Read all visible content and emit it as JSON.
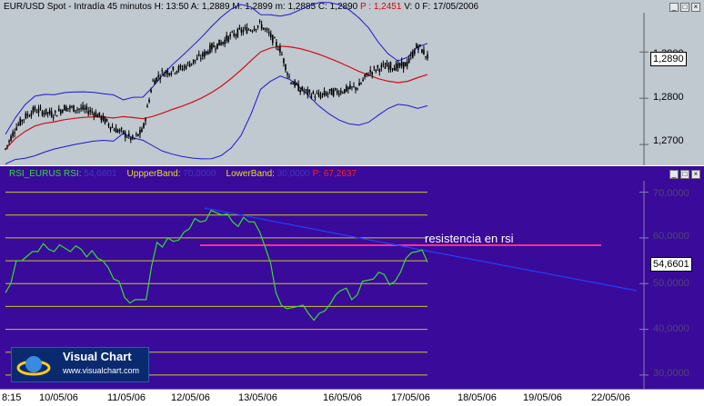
{
  "price_panel": {
    "symbol": "EUR/USD Spot",
    "period": "Intradía 45 minutos",
    "h_label": "H:",
    "h_value": "13:50",
    "a_label": "A:",
    "a_value": "1,2889",
    "m_label": "M:",
    "m_value": "1,2899",
    "mn_label": "m:",
    "mn_value": "1,2885",
    "c_label": "C:",
    "c_value": "1,2890",
    "p_label": "P :",
    "p_value": "1,2451",
    "v_label": "V:",
    "v_value": "0",
    "f_label": "F:",
    "f_value": "17/05/2006",
    "axis_ticks": [
      "1,2900",
      "1,2800",
      "1,2700"
    ],
    "last_value": "1,2890"
  },
  "rsi_panel": {
    "name": "RSI_EURUS",
    "rsi_label": "RSI:",
    "rsi_value": "54,6601",
    "upper_label": "UppperBand:",
    "upper_value": "70,0000",
    "lower_label": "LowerBand:",
    "lower_value": "30,0000",
    "p_label": "P:",
    "p_value": "67,2637",
    "annotation": "resistencia en rsi",
    "axis_ticks": [
      "70,0000",
      "60,0000",
      "50,0000",
      "40,0000",
      "30,0000"
    ],
    "last_value": "54,6601"
  },
  "x_axis": [
    "8:15",
    "10/05/06",
    "11/05/06",
    "12/05/06",
    "13/05/06",
    "16/05/06",
    "17/05/06",
    "18/05/06",
    "19/05/06",
    "22/05/06"
  ],
  "logo": {
    "title": "Visual Chart",
    "url": "www.visualchart.com"
  },
  "colors": {
    "price_bg": "#c0c8d0",
    "rsi_bg": "#3a0a9a",
    "candles": "#000000",
    "bollinger": "#1a1acc",
    "sma": "#d01010",
    "rsi_line": "#30e030",
    "band": "#c8c820",
    "resistance": "#ff3090",
    "trend": "#2040ff"
  },
  "chart_data": [
    {
      "type": "line",
      "title": "",
      "series": [
        {
          "name": "",
          "values": [
            1.269,
            1.2735,
            1.276,
            1.2775,
            1.277,
            1.2765,
            1.278,
            1.2778,
            1.2776,
            1.277,
            1.2755,
            1.2735,
            1.2725,
            1.271,
            1.273,
            1.2835,
            1.2855,
            1.286,
            1.2865,
            1.2878,
            1.289,
            1.291,
            1.292,
            1.2935,
            1.2945,
            1.295,
            1.296,
            1.2935,
            1.2905,
            1.284,
            1.282,
            1.281,
            1.2805,
            1.2812,
            1.2815,
            1.282,
            1.2825,
            1.2855,
            1.2865,
            1.287,
            1.2868,
            1.2875,
            1.2915,
            1.289
          ]
        }
      ],
      "ylim": [
        1.2655,
        1.2985
      ],
      "x_categories": [
        "8:15",
        "10/05/06",
        "11/05/06",
        "12/05/06",
        "13/05/06",
        "16/05/06",
        "17/05/06",
        "18/05/06",
        "19/05/06",
        "22/05/06"
      ]
    },
    {
      "type": "line",
      "title": "",
      "series": [
        {
          "name": "RSI",
          "values": [
            48,
            55,
            56,
            57,
            57.5,
            58.5,
            57,
            57.5,
            57.2,
            55,
            51,
            47,
            46.5,
            46.5,
            59,
            60,
            59.5,
            62,
            63.5,
            66,
            65,
            63.5,
            64.5,
            63.5,
            58,
            48,
            44.5,
            45,
            43.5,
            43.5,
            45.5,
            48.5,
            46.5,
            50.5,
            51,
            52,
            50.5,
            55.5,
            57,
            54.6601
          ]
        },
        {
          "name": "UppperBand",
          "values": [
            70,
            70
          ]
        },
        {
          "name": "LowerBand",
          "values": [
            30,
            30
          ]
        }
      ],
      "ylim": [
        27,
        72.5
      ],
      "x_categories": [
        "8:15",
        "10/05/06",
        "11/05/06",
        "12/05/06",
        "13/05/06",
        "16/05/06",
        "17/05/06",
        "18/05/06",
        "19/05/06",
        "22/05/06"
      ]
    }
  ]
}
